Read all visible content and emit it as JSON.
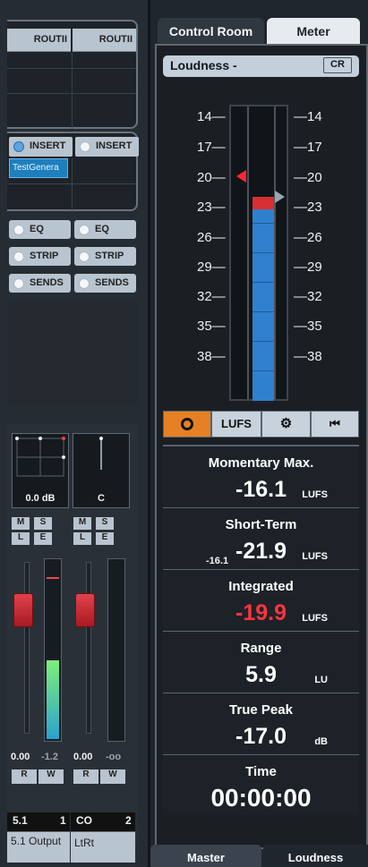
{
  "left": {
    "routing": {
      "col1": "ROUTII",
      "col2": "ROUTII"
    },
    "insert": {
      "col1": "INSERT",
      "col2": "INSERT",
      "slot": "TestGenera"
    },
    "buttons": [
      {
        "label": "EQ"
      },
      {
        "label": "EQ"
      },
      {
        "label": "STRIP"
      },
      {
        "label": "STRIP"
      },
      {
        "label": "SENDS"
      },
      {
        "label": "SENDS"
      }
    ],
    "channel1": {
      "panner_value": "0.0 dB",
      "m": "M",
      "s": "S",
      "l": "L",
      "e": "E",
      "volume": "0.00",
      "peak": "-1.2",
      "r": "R",
      "w": "W",
      "name_top": "5.1",
      "number": "1",
      "name": "5.1 Output"
    },
    "channel2": {
      "panner_value": "C",
      "m": "M",
      "s": "S",
      "l": "L",
      "e": "E",
      "volume": "0.00",
      "peak": "-oo",
      "r": "R",
      "w": "W",
      "name_top": "CO",
      "number": "2",
      "name": "LtRt"
    }
  },
  "right": {
    "tabs": {
      "control_room": "Control Room",
      "meter": "Meter"
    },
    "top_bar": {
      "title": "Loudness -",
      "cr": "CR"
    },
    "scale_labels": [
      "14—",
      "17—",
      "20—",
      "23—",
      "26—",
      "29—",
      "32—",
      "35—",
      "38—"
    ],
    "scale_labels_right": [
      "—14",
      "—17",
      "—20",
      "—23",
      "—26",
      "—29",
      "—32",
      "—35",
      "—38"
    ],
    "controls": {
      "lufs": "LUFS"
    },
    "stats": [
      {
        "label": "Momentary Max.",
        "value": "-16.1",
        "unit": "LUFS"
      },
      {
        "label": "Short-Term",
        "value": "-21.9",
        "unit": "LUFS",
        "pre": "-16.1"
      },
      {
        "label": "Integrated",
        "value": "-19.9",
        "unit": "LUFS"
      },
      {
        "label": "Range",
        "value": "5.9",
        "unit": "LU"
      },
      {
        "label": "True Peak",
        "value": "-17.0",
        "unit": "dB"
      },
      {
        "label": "Time",
        "value": "00:00:00"
      }
    ],
    "bottom_tabs": {
      "master": "Master",
      "loudness": "Loudness"
    }
  }
}
